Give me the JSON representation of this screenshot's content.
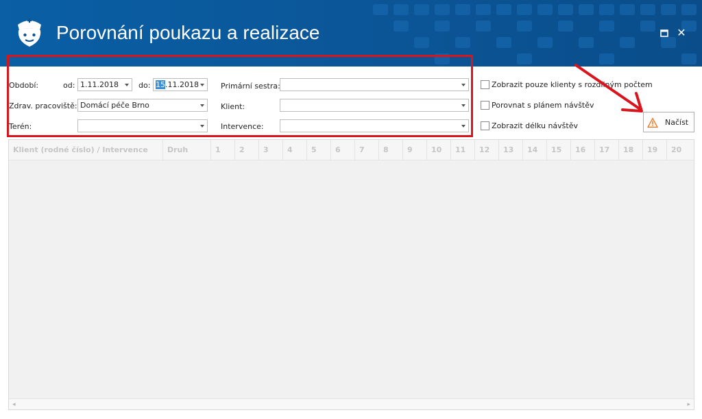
{
  "window": {
    "title": "Porovnání poukazu a realizace",
    "maximize_icon": "maximize-icon",
    "close_glyph": "✕"
  },
  "filters": {
    "period_label": "Období:",
    "from_label": "od:",
    "from_value": "1.11.2018",
    "to_label": "do:",
    "to_value_day": "15",
    "to_value_rest": ".11.2018",
    "workplace_label": "Zdrav. pracoviště:",
    "workplace_value": "Domácí péče Brno",
    "terrain_label": "Terén:",
    "terrain_value": "",
    "nurse_label": "Primární sestra:",
    "nurse_value": "",
    "client_label": "Klient:",
    "client_value": "",
    "intervention_label": "Intervence:",
    "intervention_value": ""
  },
  "options": {
    "only_diff_label": "Zobrazit pouze klienty s rozdílným počtem",
    "compare_plan_label": "Porovnat s plánem návštěv",
    "show_duration_label": "Zobrazit délku návštěv"
  },
  "load_button": {
    "label": "Načíst",
    "icon": "warning-icon"
  },
  "grid": {
    "col_client": "Klient (rodné číslo) / Intervence",
    "col_type": "Druh",
    "day_columns": [
      "1",
      "2",
      "3",
      "4",
      "5",
      "6",
      "7",
      "8",
      "9",
      "10",
      "11",
      "12",
      "13",
      "14",
      "15",
      "16",
      "17",
      "18",
      "19",
      "20"
    ]
  },
  "colors": {
    "title_bar": "#0b5597",
    "annotation_red": "#d8151c",
    "warning_orange": "#e8721c"
  }
}
